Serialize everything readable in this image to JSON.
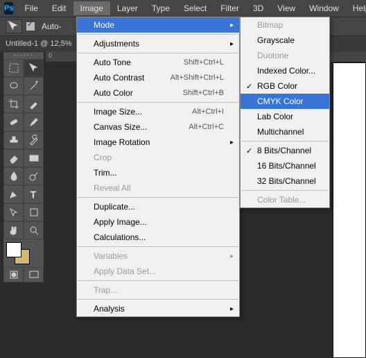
{
  "logo": "Ps",
  "menubar": {
    "file": "File",
    "edit": "Edit",
    "image": "Image",
    "layer": "Layer",
    "type": "Type",
    "select": "Select",
    "filter": "Filter",
    "threeD": "3D",
    "view": "View",
    "window": "Window",
    "help": "Help"
  },
  "optionsbar": {
    "autoSelect": "Auto-"
  },
  "docTab": "Untitled-1 @ 12,5%",
  "rulerMark": "0",
  "imageMenu": {
    "mode": "Mode",
    "adjustments": "Adjustments",
    "autoTone": "Auto Tone",
    "autoToneKey": "Shift+Ctrl+L",
    "autoContrast": "Auto Contrast",
    "autoContrastKey": "Alt+Shift+Ctrl+L",
    "autoColor": "Auto Color",
    "autoColorKey": "Shift+Ctrl+B",
    "imageSize": "Image Size...",
    "imageSizeKey": "Alt+Ctrl+I",
    "canvasSize": "Canvas Size...",
    "canvasSizeKey": "Alt+Ctrl+C",
    "imageRotation": "Image Rotation",
    "crop": "Crop",
    "trim": "Trim...",
    "revealAll": "Reveal All",
    "duplicate": "Duplicate...",
    "applyImage": "Apply Image...",
    "calculations": "Calculations...",
    "variables": "Variables",
    "applyDataSet": "Apply Data Set...",
    "trap": "Trap...",
    "analysis": "Analysis"
  },
  "modeMenu": {
    "bitmap": "Bitmap",
    "grayscale": "Grayscale",
    "duotone": "Duotone",
    "indexed": "Indexed Color...",
    "rgb": "RGB Color",
    "cmyk": "CMYK Color",
    "lab": "Lab Color",
    "multichannel": "Multichannel",
    "bits8": "8 Bits/Channel",
    "bits16": "16 Bits/Channel",
    "bits32": "32 Bits/Channel",
    "colorTable": "Color Table..."
  }
}
